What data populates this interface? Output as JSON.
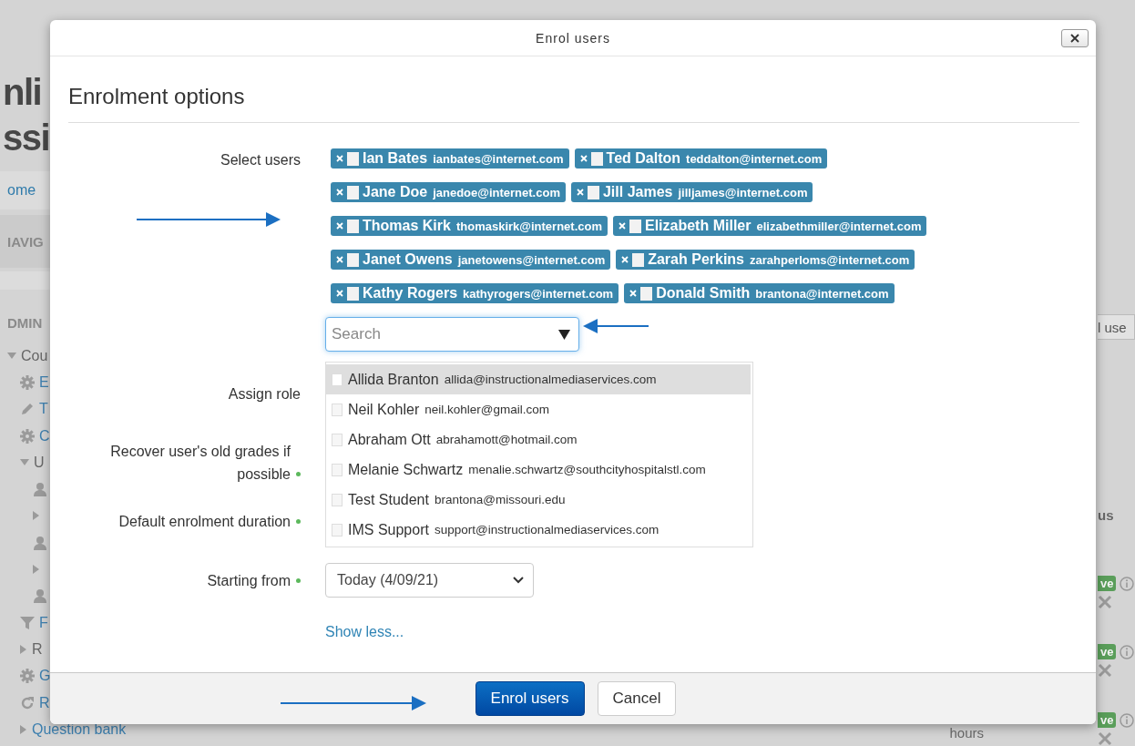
{
  "background_page": {
    "heading_lines": [
      "nli",
      "ssi"
    ],
    "breadcrumb_link": "ome",
    "navigation_block": "IAVIG",
    "admin_block": "DMIN",
    "admin_tree": [
      {
        "kind": "caret-down",
        "label": "Cou",
        "link": false,
        "children": [
          {
            "kind": "gear",
            "label": "E",
            "link": true
          },
          {
            "kind": "pencil",
            "label": "T",
            "link": true
          },
          {
            "kind": "gear",
            "label": "C",
            "link": true
          },
          {
            "kind": "caret-down",
            "label": "U",
            "link": false,
            "children": [
              {
                "kind": "person"
              },
              {
                "kind": "caret-right"
              },
              {
                "kind": "person"
              },
              {
                "kind": "caret-right"
              },
              {
                "kind": "person"
              }
            ]
          },
          {
            "kind": "filter",
            "label": "F",
            "link": true
          },
          {
            "kind": "caret-right",
            "label": "R",
            "link": false
          },
          {
            "kind": "gear",
            "label": "G",
            "link": true
          },
          {
            "kind": "refresh",
            "label": "R",
            "link": true
          },
          {
            "kind": "caret-right",
            "label": "Question bank",
            "link": true
          }
        ]
      }
    ],
    "right_button": "l use",
    "right_heading": "us",
    "status_badges": [
      "ve",
      "ve",
      "ve"
    ],
    "footer_cell": "hours"
  },
  "dialog": {
    "title": "Enrol users",
    "heading": "Enrolment options",
    "select_users": {
      "label": "Select users",
      "chips": [
        {
          "name": "Ian Bates",
          "email": "ianbates@internet.com"
        },
        {
          "name": "Ted Dalton",
          "email": "teddalton@internet.com"
        },
        {
          "name": "Jane Doe",
          "email": "janedoe@internet.com"
        },
        {
          "name": "Jill James",
          "email": "jilljames@internet.com"
        },
        {
          "name": "Thomas Kirk",
          "email": "thomaskirk@internet.com"
        },
        {
          "name": "Elizabeth Miller",
          "email": "elizabethmiller@internet.com"
        },
        {
          "name": "Janet Owens",
          "email": "janetowens@internet.com"
        },
        {
          "name": "Zarah Perkins",
          "email": "zarahperloms@internet.com"
        },
        {
          "name": "Kathy Rogers",
          "email": "kathyrogers@internet.com"
        },
        {
          "name": "Donald Smith",
          "email": "brantona@internet.com"
        }
      ],
      "search": {
        "placeholder": "Search"
      },
      "options": [
        {
          "name": "Allida Branton",
          "email": "allida@instructionalmediaservices.com",
          "selected": true
        },
        {
          "name": "Neil Kohler",
          "email": "neil.kohler@gmail.com",
          "selected": false
        },
        {
          "name": "Abraham Ott",
          "email": "abrahamott@hotmail.com",
          "selected": false
        },
        {
          "name": "Melanie Schwartz",
          "email": "menalie.schwartz@southcityhospitalstl.com",
          "selected": false
        },
        {
          "name": "Test Student",
          "email": "brantona@missouri.edu",
          "selected": false
        },
        {
          "name": "IMS Support",
          "email": "support@instructionalmediaservices.com",
          "selected": false
        }
      ]
    },
    "assign_role": {
      "label": "Assign role"
    },
    "recover_grades": {
      "label": "Recover user's old grades if possible",
      "required": true
    },
    "duration": {
      "label": "Default enrolment duration",
      "required": true
    },
    "starting_from": {
      "label": "Starting from",
      "required": true,
      "value": "Today (4/09/21)"
    },
    "show_less": "Show less...",
    "buttons": [
      {
        "label": "Enrol users",
        "kind": "primary"
      },
      {
        "label": "Cancel",
        "kind": "secondary"
      }
    ]
  }
}
